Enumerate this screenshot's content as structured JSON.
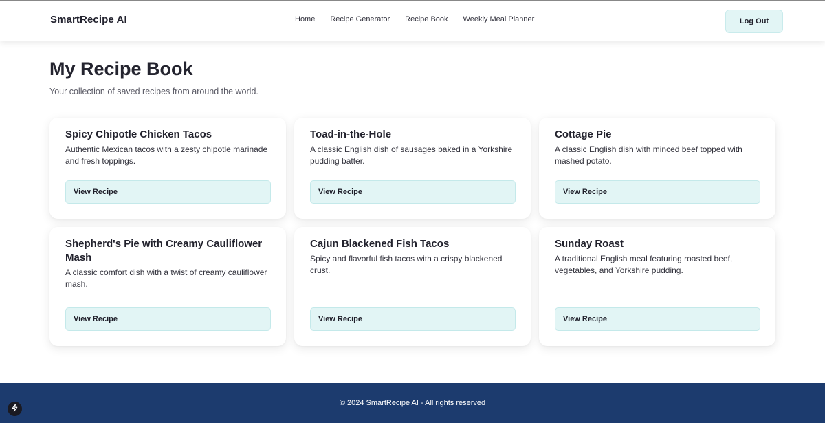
{
  "navbar": {
    "brand": "SmartRecipe AI",
    "links": [
      {
        "label": "Home"
      },
      {
        "label": "Recipe Generator"
      },
      {
        "label": "Recipe Book"
      },
      {
        "label": "Weekly Meal Planner"
      }
    ],
    "logout_label": "Log Out"
  },
  "page": {
    "title": "My Recipe Book",
    "subtitle": "Your collection of saved recipes from around the world."
  },
  "recipes": [
    {
      "title": "Spicy Chipotle Chicken Tacos",
      "description": "Authentic Mexican tacos with a zesty chipotle marinade and fresh toppings.",
      "button": "View Recipe"
    },
    {
      "title": "Toad-in-the-Hole",
      "description": "A classic English dish of sausages baked in a Yorkshire pudding batter.",
      "button": "View Recipe"
    },
    {
      "title": "Cottage Pie",
      "description": "A classic English dish with minced beef topped with mashed potato.",
      "button": "View Recipe"
    },
    {
      "title": "Shepherd's Pie with Creamy Cauliflower Mash",
      "description": "A classic comfort dish with a twist of creamy cauliflower mash.",
      "button": "View Recipe"
    },
    {
      "title": "Cajun Blackened Fish Tacos",
      "description": "Spicy and flavorful fish tacos with a crispy blackened crust.",
      "button": "View Recipe"
    },
    {
      "title": "Sunday Roast",
      "description": "A traditional English meal featuring roasted beef, vegetables, and Yorkshire pudding.",
      "button": "View Recipe"
    }
  ],
  "footer": {
    "text": "© 2024 SmartRecipe AI - All rights reserved"
  },
  "colors": {
    "accent_button_bg": "#e2f5f5",
    "footer_bg": "#1c3b6e"
  }
}
